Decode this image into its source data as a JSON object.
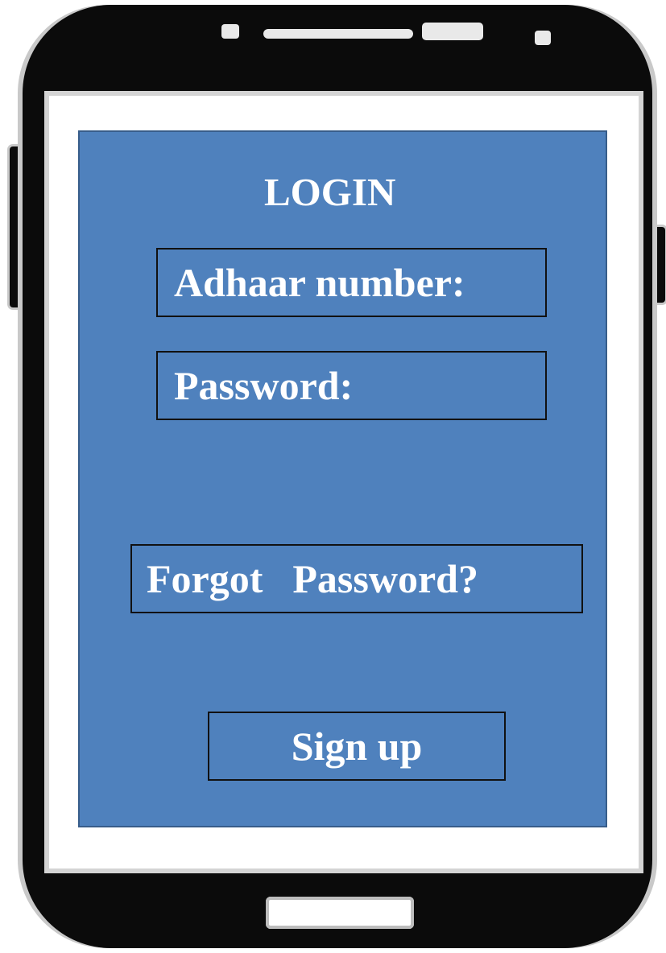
{
  "login": {
    "title": "LOGIN",
    "adhaar_label": "Adhaar number:",
    "password_label": "Password:",
    "forgot_password": "Forgot  Password?",
    "sign_up": "Sign up"
  },
  "colors": {
    "panel": "#4f81bd",
    "panel_border": "#385d8a",
    "phone_body": "#0b0b0b",
    "text": "#ffffff"
  }
}
